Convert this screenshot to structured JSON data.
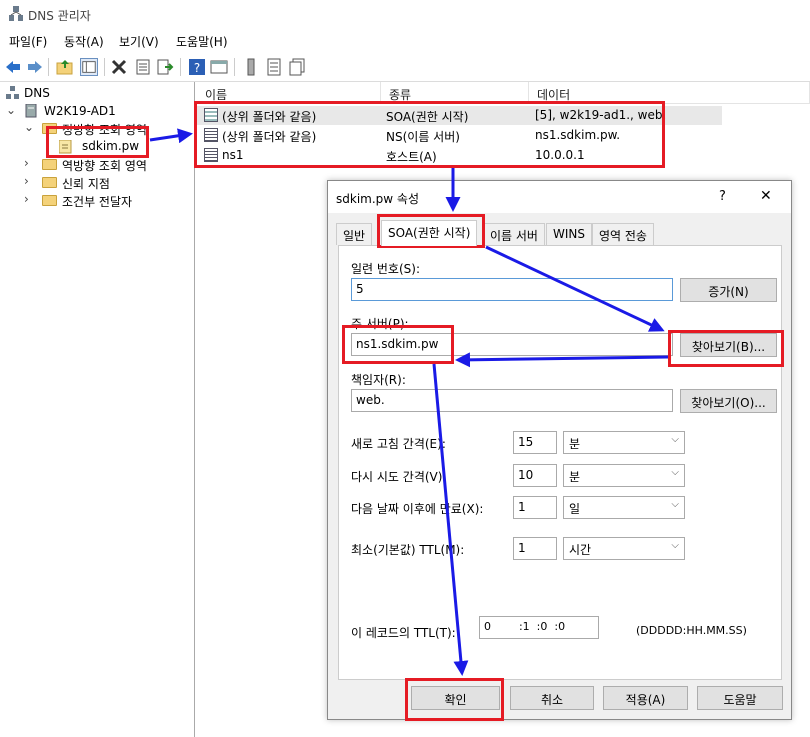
{
  "window": {
    "title": "DNS 관리자"
  },
  "menu": [
    "파일(F)",
    "동작(A)",
    "보기(V)",
    "도움말(H)"
  ],
  "tree": {
    "root": "DNS",
    "server": "W2K19-AD1",
    "forward_zones": "정방향 조회 영역",
    "zone": "sdkim.pw",
    "reverse_zones": "역방향 조회 영역",
    "trust_points": "신뢰 지점",
    "conditional_forwarders": "조건부 전달자"
  },
  "list": {
    "columns": [
      "이름",
      "종류",
      "데이터"
    ],
    "rows": [
      {
        "name": "(상위 폴더와 같음)",
        "type": "SOA(권한 시작)",
        "data": "[5], w2k19-ad1., web."
      },
      {
        "name": "(상위 폴더와 같음)",
        "type": "NS(이름 서버)",
        "data": "ns1.sdkim.pw."
      },
      {
        "name": "ns1",
        "type": "호스트(A)",
        "data": "10.0.0.1"
      }
    ]
  },
  "dialog": {
    "title": "sdkim.pw 속성",
    "help": "?",
    "close": "✕",
    "tabs": [
      "일반",
      "SOA(권한 시작)",
      "이름 서버",
      "WINS",
      "영역 전송"
    ],
    "serial_label": "일련 번호(S):",
    "serial_value": "5",
    "increment_button": "증가(N)",
    "primary_label": "주 서버(P):",
    "primary_value": "ns1.sdkim.pw",
    "browse_b": "찾아보기(B)...",
    "responsible_label": "책임자(R):",
    "responsible_value": "web.",
    "browse_o": "찾아보기(O)...",
    "refresh_label": "새로 고침 간격(E):",
    "refresh_value": "15",
    "refresh_unit": "분",
    "retry_label": "다시 시도 간격(V):",
    "retry_value": "10",
    "retry_unit": "분",
    "expire_label": "다음 날짜 이후에 만료(X):",
    "expire_value": "1",
    "expire_unit": "일",
    "min_ttl_label": "최소(기본값) TTL(M):",
    "min_ttl_value": "1",
    "min_ttl_unit": "시간",
    "record_ttl_label": "이 레코드의 TTL(T):",
    "record_ttl_value": "0        :1  :0  :0",
    "record_ttl_format": "(DDDDD:HH.MM.SS)",
    "ok": "확인",
    "cancel": "취소",
    "apply": "적용(A)",
    "help_button": "도움말"
  },
  "colors": {
    "highlight": "#e51b24",
    "arrow": "#1a1ae6",
    "folder": "#f4d27a"
  }
}
